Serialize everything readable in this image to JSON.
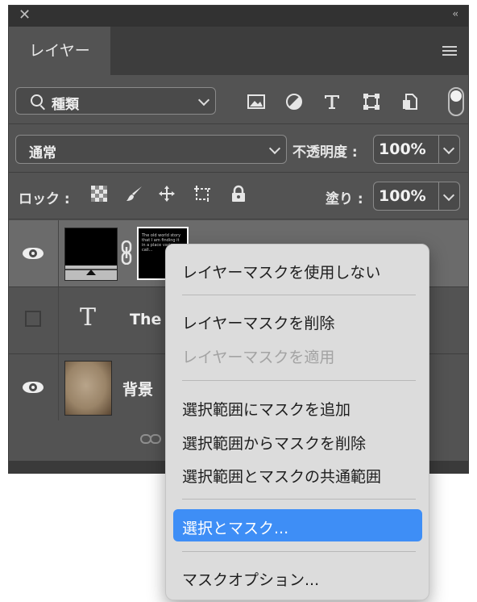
{
  "panel": {
    "close_glyph": "✕",
    "collapse_glyph": "‹‹",
    "tab_label": "レイヤー",
    "menu_icon": "hamburger-menu-icon"
  },
  "filter": {
    "label": "種類",
    "icons": [
      "image-filter-icon",
      "adjustment-filter-icon",
      "type-filter-icon",
      "shape-filter-icon",
      "smart-object-filter-icon"
    ]
  },
  "blend": {
    "mode": "通常",
    "opacity_label": "不透明度 :",
    "opacity_value": "100%"
  },
  "lock": {
    "label": "ロック :",
    "icons": [
      "lock-transparent-pixels-icon",
      "lock-image-pixels-icon",
      "lock-position-icon",
      "lock-artboard-icon",
      "lock-all-icon"
    ],
    "fill_label": "塗り :",
    "fill_value": "100%"
  },
  "layers": [
    {
      "name": "",
      "visible": true,
      "selected": true,
      "thumb_text": "The old world story that I am finding it in a place various call…"
    },
    {
      "name": "The",
      "visible": false,
      "selected": false,
      "type_glyph": "T"
    },
    {
      "name": "背景",
      "visible": true,
      "selected": false
    }
  ],
  "context_menu": {
    "items": [
      {
        "label": "レイヤーマスクを使用しない",
        "enabled": true
      },
      {
        "label": "レイヤーマスクを削除",
        "enabled": true
      },
      {
        "label": "レイヤーマスクを適用",
        "enabled": false
      },
      {
        "label": "選択範囲にマスクを追加",
        "enabled": true
      },
      {
        "label": "選択範囲からマスクを削除",
        "enabled": true
      },
      {
        "label": "選択範囲とマスクの共通範囲",
        "enabled": true
      },
      {
        "label": "選択とマスク...",
        "enabled": true,
        "highlighted": true
      },
      {
        "label": "マスクオプション...",
        "enabled": true
      }
    ]
  },
  "colors": {
    "highlight": "#3e8ef6",
    "panel_bg": "#535353"
  }
}
